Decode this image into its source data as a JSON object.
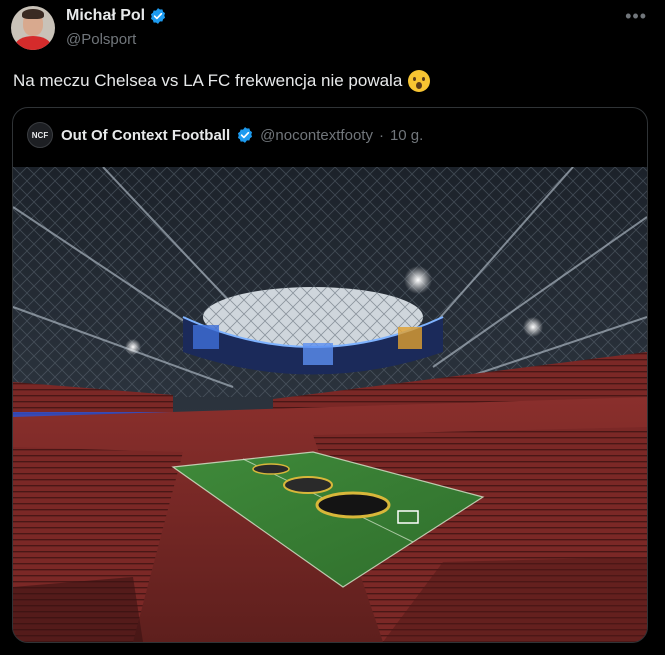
{
  "author": {
    "display_name": "Michał Pol",
    "handle": "@Polsport",
    "verified": true,
    "avatar": "avatar-photo"
  },
  "more_icon": "more-horizontal-icon",
  "tweet": {
    "text": "Na meczu Chelsea vs LA FC frekwencja nie powala",
    "emoji": "astonished-face-emoji"
  },
  "quoted": {
    "avatar_label": "NCF",
    "display_name": "Out Of Context Football",
    "verified": true,
    "handle": "@nocontextfooty",
    "separator": "·",
    "time": "10 g.",
    "media": "stadium-photo"
  },
  "colors": {
    "background": "#000000",
    "text": "#e7e9ea",
    "muted": "#71767b",
    "border": "#2f3336",
    "verified": "#1d9bf0"
  }
}
